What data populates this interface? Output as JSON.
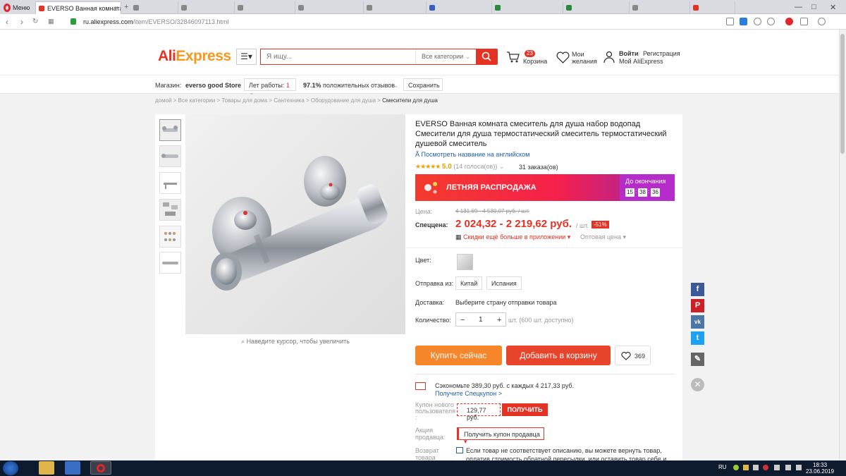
{
  "browser": {
    "menu_label": "Меню",
    "active_tab": "EVERSO Ванная комната с",
    "other_tabs": [
      "",
      "",
      "",
      "",
      "",
      "",
      "",
      "",
      "",
      ""
    ],
    "url_host": "ru.aliexpress.com",
    "url_path": "/item/EVERSO/32846097113.html",
    "window_controls": [
      "—",
      "□",
      "✕"
    ]
  },
  "header": {
    "logo_ali": "Ali",
    "logo_express": "Express",
    "search_placeholder": "Я ищу...",
    "category_select": "Все категории",
    "cart_label": "Корзина",
    "cart_count": "23",
    "wishlist_line1": "Мои",
    "wishlist_line2": "желания",
    "login": "Войти",
    "register": "Регистрация",
    "my_ali": "Мой AliExpress"
  },
  "store": {
    "label": "Магазин:",
    "name": "everso good Store",
    "years_label": "Лет работы:",
    "years_value": "1",
    "rating_value": "97.1%",
    "rating_label": "положительных отзывов",
    "save_button": "Сохранить"
  },
  "breadcrumb": [
    "домой",
    "Все категории",
    "Товары для дома",
    "Сантехника",
    "Оборудование для душа",
    "Смесители для душа"
  ],
  "product": {
    "title": "EVERSO Ванная комната смеситель для душа набор водопад Смесители для душа термостатический смеситель термостатический душевой смеситель",
    "translate_link": "Посмотреть название на английском",
    "stars": "★★★★★",
    "rating": "5.0",
    "votes": "(14 голоса(ов))",
    "orders": "31 заказа(ов)",
    "sale_label": "ЛЕТНЯЯ РАСПРОДАЖА",
    "sale_ends": "До окончания",
    "countdown": [
      "15",
      "38",
      "36"
    ],
    "price_label": "Цена:",
    "old_price": "4 131,69 - 4 530,07 руб. / шт.",
    "special_label": "Спеццена:",
    "price": "2 024,32 - 2 219,62 руб.",
    "unit": "/ шт.",
    "discount": "-51%",
    "app_deal": "Скидки ещё больше в приложении",
    "wholesale": "Оптовая цена",
    "color_label": "Цвет:",
    "ship_from_label": "Отправка из:",
    "ship_options": [
      "Китай",
      "Испания"
    ],
    "delivery_label": "Доставка:",
    "delivery_value": "Выберите страну отправки товара",
    "qty_label": "Количество:",
    "qty_minus": "−",
    "qty_value": "1",
    "qty_plus": "+",
    "qty_available": "шт. (600 шт. доступно)",
    "zoom_hint": "Наведите курсор, чтобы увеличить",
    "buy_now": "Купить сейчас",
    "add_to_cart": "Добавить в корзину",
    "wish_count": "369",
    "save_text": "Сэкономьте 389,30 руб. с каждых 4 217,33 руб.",
    "save_link": "Получите Спецкупон >",
    "new_user_label_1": "Купон нового",
    "new_user_label_2": "пользователя",
    "new_user_label_3": ":",
    "coupon_value": "129,77 руб.",
    "coupon_button": "ПОЛУЧИТЬ",
    "seller_promo_1": "Акция",
    "seller_promo_2": "продавца:",
    "seller_coupon": "Получить купон продавца",
    "return_label_1": "Возврат",
    "return_label_2": "товара",
    "return_text": "Если товар не соответствует описанию, вы можете вернуть товар, оплатив стоимость обратной пересылки, или оставить товар себе и"
  },
  "social": {
    "facebook": "f",
    "pinterest": "P",
    "vk": "vk",
    "twitter": "t",
    "edit": "✎",
    "close": "✕"
  },
  "taskbar": {
    "lang": "RU",
    "time": "18:33",
    "date": "23.06.2019"
  },
  "colors": {
    "brand_red": "#e43225",
    "brand_orange": "#f7862a",
    "link_blue": "#1f5fb0",
    "sale_purple": "#b52ccb"
  }
}
